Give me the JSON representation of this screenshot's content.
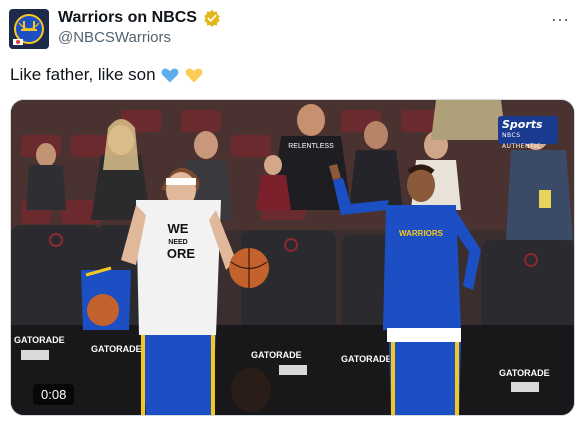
{
  "account": {
    "display_name": "Warriors on NBCS",
    "handle": "@NBCSWarriors",
    "verified": true,
    "verified_color": "#e2b719",
    "avatar_icon": "warriors-bridge-logo"
  },
  "menu": {
    "icon": "more-horizontal-icon",
    "label": "···"
  },
  "tweet": {
    "text": "Like father, like son",
    "emoji": [
      "blue-heart",
      "yellow-heart"
    ]
  },
  "media": {
    "type": "video",
    "timestamp": "0:08",
    "watermark_main": "Sports",
    "watermark_sub": "NBCS AUTHENTIC",
    "shirt_text_line1": "WE",
    "shirt_text_line2": "NEED",
    "shirt_text_line3": "ORE",
    "jersey_text": "WARRIORS",
    "sign_gatorade": "GATORADE",
    "crowd_shirt_text": "RELENTLESS"
  },
  "colors": {
    "warriors_blue": "#1d4fc4",
    "warriors_gold": "#f6c81f",
    "handle_gray": "#536471"
  }
}
